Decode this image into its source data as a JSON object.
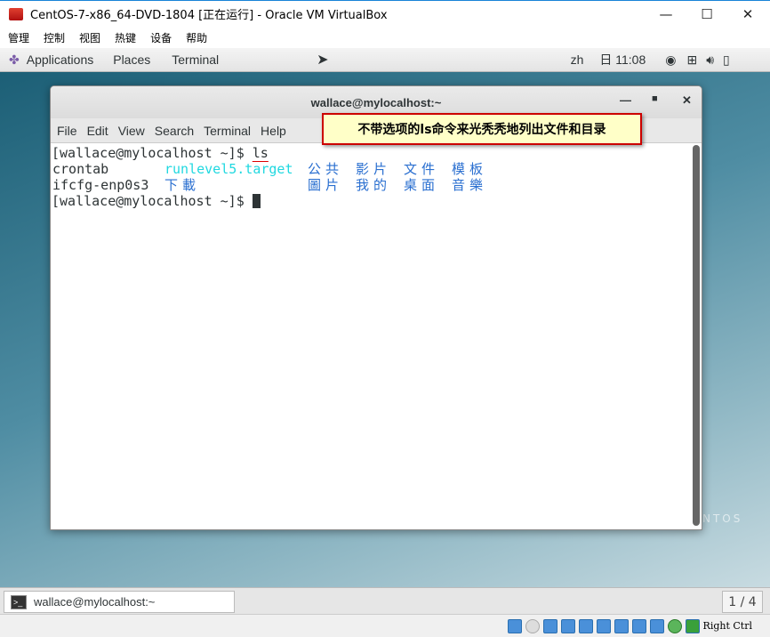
{
  "vbox": {
    "title": "CentOS-7-x86_64-DVD-1804 [正在运行] - Oracle VM VirtualBox",
    "menu": [
      "管理",
      "控制",
      "视图",
      "热键",
      "设备",
      "帮助"
    ],
    "host_key": "Right Ctrl"
  },
  "gnome": {
    "applications": "Applications",
    "places": "Places",
    "terminal": "Terminal",
    "lang": "zh",
    "clock": "日 11:08"
  },
  "terminal": {
    "title": "wallace@mylocalhost:~",
    "menu": [
      "File",
      "Edit",
      "View",
      "Search",
      "Terminal",
      "Help"
    ],
    "prompt": "[wallace@mylocalhost ~]$ ",
    "command": "ls",
    "row1": [
      "crontab",
      "runlevel5.target",
      "公共",
      "影片",
      "文件",
      "模板"
    ],
    "row2": [
      "ifcfg-enp0s3",
      "下載",
      "圖片",
      "我的",
      "桌面",
      "音樂"
    ]
  },
  "tooltip": "不带选项的ls命令来光秃秃地列出文件和目录",
  "taskbar": {
    "item": "wallace@mylocalhost:~",
    "pager": "1 / 4"
  },
  "colors": {
    "tooltip_bg": "#ffffc8",
    "tooltip_border": "#cc0000",
    "dir": "#2a6fd0",
    "link": "#20d8e0"
  }
}
